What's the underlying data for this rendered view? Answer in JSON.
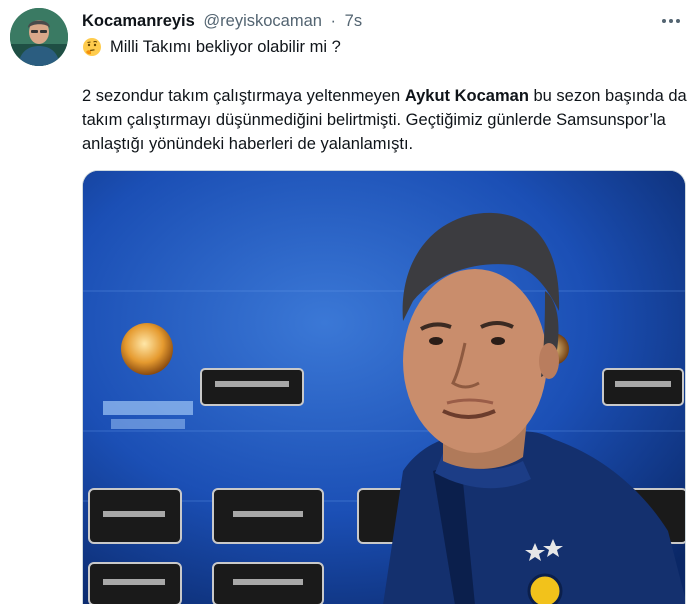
{
  "tweet": {
    "display_name": "Kocamanreyis",
    "handle": "@reyiskocaman",
    "separator": "·",
    "time": "7s",
    "line1_emoji": "thinking-face-emoji",
    "line1_text": "Milli Takımı bekliyor olabilir mi ?",
    "body_part1": " 2 sezondur takım çalıştırmaya yeltenmeyen ",
    "body_bold": "Aykut Kocaman",
    "body_part2": " bu sezon başında da takım çalıştırmayı düşünmediğini belirtmişti. Geçtiğimiz günlerde Samsunspor’la anlaştığı yönündeki haberleri de yalanlamıştı.",
    "photo_subject": "man in navy track jacket in front of a blue press-conference backdrop"
  },
  "colors": {
    "text_primary": "#0f1419",
    "text_secondary": "#536471",
    "media_border": "#cfd9de",
    "backdrop_blue": "#1b4fb5"
  },
  "icons": {
    "more": "more-horizontal-icon"
  }
}
